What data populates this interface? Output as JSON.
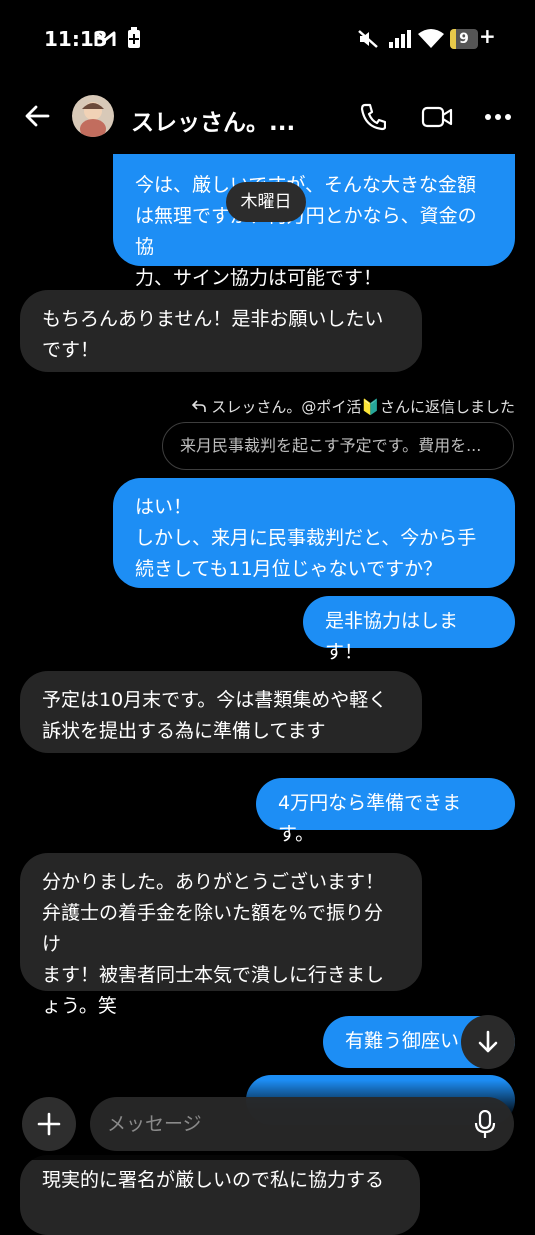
{
  "status": {
    "time": "11:13",
    "battery": "9"
  },
  "header": {
    "name": "スレッさん。..."
  },
  "date_chip": "木曜日",
  "messages": [
    {
      "side": "out",
      "lines": [
        "今は、厳しいですが、そんな大きな金額",
        "は無理ですが、何万円とかなら、資金の協",
        "力、サイン協力は可能です！"
      ]
    },
    {
      "side": "in",
      "lines": [
        "もちろんありません！是非お願いしたい",
        "です！"
      ]
    },
    {
      "side": "out",
      "lines": [
        "はい！",
        "しかし、来月に民事裁判だと、今から手",
        "続きしても11月位じゃないですか？"
      ]
    },
    {
      "side": "out",
      "lines": [
        "是非協力はします！"
      ]
    },
    {
      "side": "in",
      "lines": [
        "予定は10月末です。今は書類集めや軽く",
        "訴状を提出する為に準備してます"
      ]
    },
    {
      "side": "out",
      "lines": [
        "4万円なら準備できます。"
      ]
    },
    {
      "side": "in",
      "lines": [
        "分かりました。ありがとうございます！",
        "弁護士の着手金を除いた額を%で振り分け",
        "ます！被害者同士本気で潰しに行きまし",
        "ょう。笑"
      ]
    },
    {
      "side": "out",
      "lines": [
        "有難う御座います"
      ]
    },
    {
      "side": "in",
      "lines": [
        "現実的に署名が厳しいので私に協力する"
      ]
    }
  ],
  "reply": {
    "label": "スレッさん。@ポイ活🔰さんに返信しました",
    "quote": "来月民事裁判を起こす予定です。費用を..."
  },
  "composer": {
    "placeholder": "メッセージ"
  }
}
